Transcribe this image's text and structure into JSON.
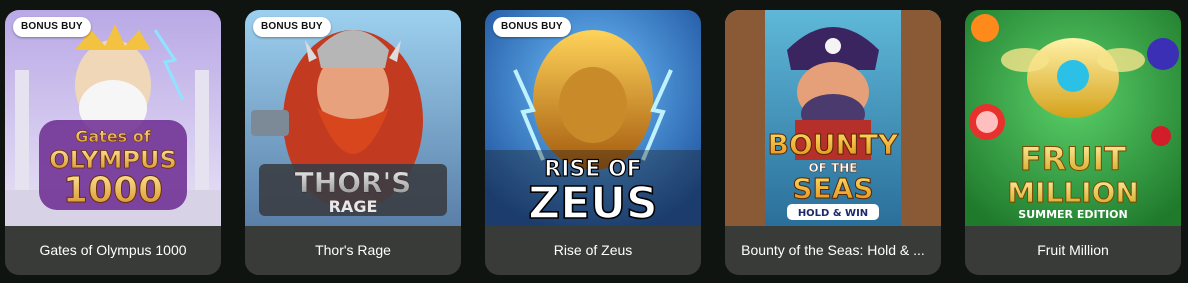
{
  "games": [
    {
      "title": "Gates of Olympus 1000",
      "badge": "BONUS BUY",
      "logo": [
        "Gates of",
        "OLYMPUS",
        "1000"
      ]
    },
    {
      "title": "Thor's Rage",
      "badge": "BONUS BUY",
      "logo": [
        "THOR'S",
        "RAGE"
      ]
    },
    {
      "title": "Rise of Zeus",
      "badge": "BONUS BUY",
      "logo": [
        "RISE OF",
        "ZEUS"
      ]
    },
    {
      "title": "Bounty of the Seas: Hold & ...",
      "logo": [
        "BOUNTY",
        "OF THE",
        "SEAS",
        "HOLD & WIN"
      ]
    },
    {
      "title": "Fruit Million",
      "logo": [
        "FRUIT",
        "MILLION",
        "SUMMER EDITION"
      ]
    }
  ],
  "colors": {
    "page_background": "#0f1410",
    "caption_background": "#383b38",
    "badge_background": "#ffffff"
  }
}
